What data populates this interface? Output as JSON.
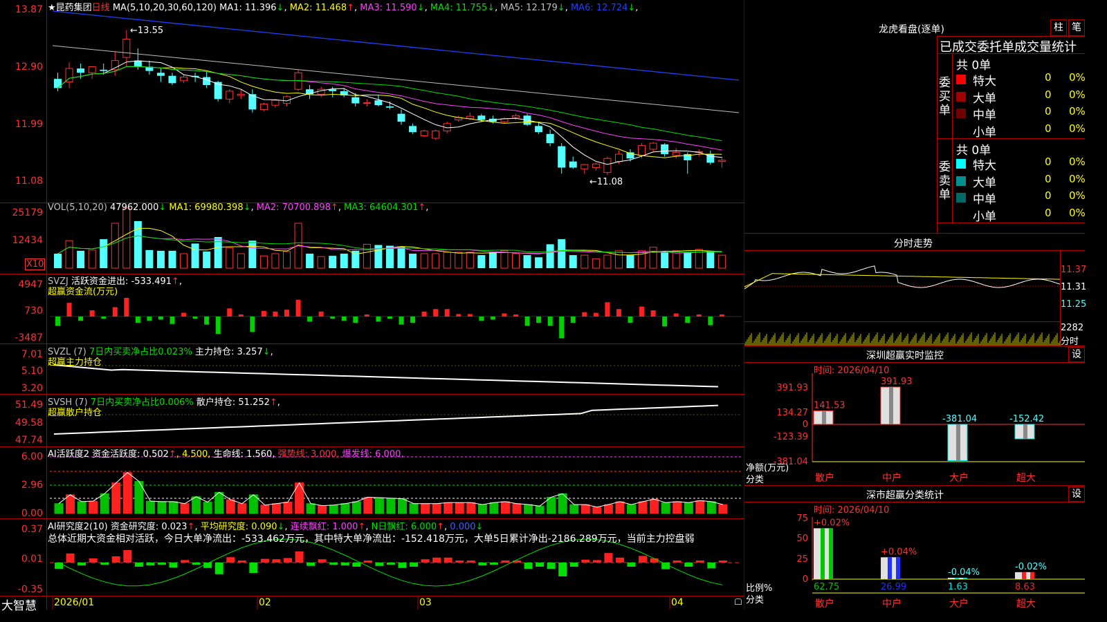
{
  "stock": {
    "star": "★",
    "name": "昆药集团",
    "period": "日线"
  },
  "price_panel": {
    "ma_header": "MA(5,10,20,30,60,120)",
    "ma": [
      {
        "label": "MA1:",
        "value": "11.396",
        "arrow": "↓",
        "color": "#ffffff"
      },
      {
        "label": "MA2:",
        "value": "11.468",
        "arrow": "↑",
        "color": "#ffff00"
      },
      {
        "label": "MA3:",
        "value": "11.590",
        "arrow": "↓",
        "color": "#ff40ff"
      },
      {
        "label": "MA4:",
        "value": "11.755",
        "arrow": "↓",
        "color": "#00e000"
      },
      {
        "label": "MA5:",
        "value": "12.179",
        "arrow": "↓",
        "color": "#c0c0c0"
      },
      {
        "label": "MA6:",
        "value": "12.724",
        "arrow": "↓",
        "color": "#2040ff"
      }
    ],
    "y_ticks": [
      "13.87",
      "12.90",
      "11.99",
      "11.08"
    ],
    "high_label": "13.55",
    "low_label": "11.08"
  },
  "vol_panel": {
    "header": "VOL(5,10,20)",
    "value": "47962.000",
    "value_arrow": "↓",
    "ma": [
      {
        "label": "MA1:",
        "value": "69980.398",
        "arrow": "↓",
        "color": "#ffff00"
      },
      {
        "label": "MA2:",
        "value": "70700.898",
        "arrow": "↑",
        "color": "#ff40ff"
      },
      {
        "label": "MA3:",
        "value": "64604.301",
        "arrow": "↑",
        "color": "#00e000"
      }
    ],
    "y_ticks": [
      "25179",
      "12434"
    ],
    "unit": "X10"
  },
  "svzj_panel": {
    "header": "SVZJ",
    "label": "活跃资金进出:",
    "value": "-533.491",
    "arrow": "↑",
    "sub": "超赢资金流(万元)",
    "y_ticks": [
      "4947",
      "730",
      "-3487"
    ]
  },
  "svzl_panel": {
    "header": "SVZL (7)",
    "label": "7日内买卖净占比0.023%",
    "label2": "主力持仓:",
    "value": "3.257",
    "arrow": "↓",
    "sub": "超赢主力持仓",
    "y_ticks": [
      "7.01",
      "5.10",
      "3.20"
    ]
  },
  "svsh_panel": {
    "header": "SVSH (7)",
    "label": "7日内买卖净占比0.006%",
    "label2": "散户持仓:",
    "value": "51.252",
    "arrow": "↑",
    "sub": "超赢散户持仓",
    "y_ticks": [
      "51.49",
      "49.58",
      "47.74"
    ]
  },
  "ai_active_panel": {
    "header": "AI活跃度2",
    "label": "资金活跃度:",
    "value": "0.502",
    "v2": "4.500",
    "label3": "生命线:",
    "v3": "1.560",
    "label4": "强势线:",
    "v4": "3.000",
    "label5": "爆发线:",
    "v5": "6.000",
    "y_ticks": [
      "6.00",
      "2.96",
      "0.00"
    ]
  },
  "ai_research_panel": {
    "header": "AI研究度2(10)",
    "label": "资金研究度:",
    "value": "0.023",
    "label2": "平均研究度:",
    "value2": "0.090",
    "label3": "连续飘红:",
    "value3": "1.000",
    "label4": "N日飘红:",
    "value4": "6.000",
    "value5": "0.000",
    "summary": "总体近期大资金相对活跃，今日大单净流出：-533.462万元，其中特大单净流出：-152.418万元，大单5日累计净出-2186.289万元，当前主力控盘弱",
    "y_ticks": [
      "0.37",
      "0.01",
      "-0.35"
    ]
  },
  "date_axis": {
    "brand": "大智慧",
    "labels": [
      "2026/01",
      "02",
      "03",
      "04"
    ]
  },
  "right": {
    "dragon_title": "龙虎看盘(逐单)",
    "tab_zhu": "柱",
    "tab_bi": "笔",
    "stat_title": "已成交委托单成交量统计",
    "buy_side": "委买单",
    "sell_side": "委卖单",
    "buy_total": "共 0单",
    "sell_total": "共 0单",
    "buy_rows": [
      {
        "name": "特大",
        "count": "0",
        "pct": "0%",
        "color": "#ff0000"
      },
      {
        "name": "大单",
        "count": "0",
        "pct": "0%",
        "color": "#a00000"
      },
      {
        "name": "中单",
        "count": "0",
        "pct": "0%",
        "color": "#700000"
      },
      {
        "name": "小单",
        "count": "0",
        "pct": "0%",
        "color": ""
      }
    ],
    "sell_rows": [
      {
        "name": "特大",
        "count": "0",
        "pct": "0%",
        "color": "#00ffff"
      },
      {
        "name": "大单",
        "count": "0",
        "pct": "0%",
        "color": "#009090"
      },
      {
        "name": "中单",
        "count": "0",
        "pct": "0%",
        "color": "#006868"
      },
      {
        "name": "小单",
        "count": "0",
        "pct": "0%",
        "color": ""
      }
    ],
    "intraday_title": "分时走势",
    "intraday_y": [
      "11.37",
      "11.31",
      "11.25"
    ],
    "intraday_vol": "2282",
    "intraday_vol_unit": "分时",
    "monitor_title": "深圳超赢实时监控",
    "set_label": "设",
    "monitor_time": "时间: 2026/04/10",
    "monitor_y": [
      "391.93",
      "134.27",
      "0",
      "-123.39",
      "-381.04"
    ],
    "monitor_ylabel": "净额(万元)",
    "monitor_xlabel": "分类",
    "monitor_bars": [
      {
        "cat": "散户",
        "value": 141.53,
        "label": "141.53"
      },
      {
        "cat": "中户",
        "value": 391.93,
        "label": "391.93"
      },
      {
        "cat": "大户",
        "value": -381.04,
        "label": "-381.04"
      },
      {
        "cat": "超大",
        "value": -152.42,
        "label": "-152.42"
      }
    ],
    "class_title": "深市超赢分类统计",
    "class_time": "时间: 2026/04/10",
    "class_y": [
      "75",
      "50",
      "25",
      "0"
    ],
    "class_ylabel": "比例%",
    "class_xlabel": "分类",
    "class_bars": [
      {
        "cat": "散户",
        "value": 62.75,
        "label": "62.75",
        "delta": "+0.02%",
        "color": "#00c800"
      },
      {
        "cat": "中户",
        "value": 26.99,
        "label": "26.99",
        "delta": "+0.04%",
        "color": "#2030ff"
      },
      {
        "cat": "大户",
        "value": 1.63,
        "label": "1.63",
        "delta": "-0.04%",
        "color": "#00e0e0"
      },
      {
        "cat": "超大",
        "value": 8.63,
        "label": "8.63",
        "delta": "-0.02%",
        "color": "#ff2020"
      }
    ]
  },
  "chart_data": {
    "type": "candlestick",
    "ylim": [
      11.08,
      13.87
    ],
    "dates": [
      "2026/01",
      "02",
      "03",
      "04"
    ],
    "ohlc": [
      [
        12.75,
        12.85,
        12.55,
        12.6
      ],
      [
        12.7,
        13.02,
        12.6,
        12.92
      ],
      [
        12.92,
        13.0,
        12.75,
        12.85
      ],
      [
        12.85,
        12.96,
        12.75,
        12.95
      ],
      [
        12.9,
        13.0,
        12.82,
        12.88
      ],
      [
        12.9,
        13.2,
        12.8,
        13.05
      ],
      [
        13.1,
        13.55,
        12.95,
        13.4
      ],
      [
        13.05,
        13.25,
        12.9,
        12.95
      ],
      [
        12.95,
        13.05,
        12.82,
        12.88
      ],
      [
        12.85,
        12.92,
        12.7,
        12.8
      ],
      [
        12.8,
        12.85,
        12.65,
        12.68
      ],
      [
        12.72,
        12.82,
        12.68,
        12.78
      ],
      [
        12.8,
        12.85,
        12.7,
        12.78
      ],
      [
        12.78,
        12.88,
        12.6,
        12.65
      ],
      [
        12.7,
        12.72,
        12.38,
        12.42
      ],
      [
        12.42,
        12.58,
        12.35,
        12.55
      ],
      [
        12.48,
        12.58,
        12.42,
        12.5
      ],
      [
        12.5,
        12.58,
        12.2,
        12.25
      ],
      [
        12.25,
        12.36,
        12.22,
        12.34
      ],
      [
        12.32,
        12.42,
        12.28,
        12.4
      ],
      [
        12.35,
        12.48,
        12.3,
        12.46
      ],
      [
        12.58,
        12.9,
        12.55,
        12.85
      ],
      [
        12.58,
        12.65,
        12.42,
        12.5
      ],
      [
        12.5,
        12.62,
        12.45,
        12.58
      ],
      [
        12.58,
        12.62,
        12.45,
        12.55
      ],
      [
        12.55,
        12.6,
        12.45,
        12.48
      ],
      [
        12.45,
        12.52,
        12.3,
        12.35
      ],
      [
        12.35,
        12.42,
        12.3,
        12.36
      ],
      [
        12.4,
        12.48,
        12.3,
        12.32
      ],
      [
        12.3,
        12.38,
        12.25,
        12.28
      ],
      [
        12.18,
        12.25,
        12.0,
        12.05
      ],
      [
        11.98,
        12.02,
        11.85,
        11.88
      ],
      [
        11.82,
        11.92,
        11.8,
        11.9
      ],
      [
        11.78,
        11.92,
        11.75,
        11.9
      ],
      [
        11.9,
        12.05,
        11.86,
        12.02
      ],
      [
        12.08,
        12.15,
        12.05,
        12.12
      ],
      [
        12.1,
        12.2,
        12.08,
        12.14
      ],
      [
        12.15,
        12.18,
        12.05,
        12.08
      ],
      [
        12.1,
        12.15,
        12.02,
        12.05
      ],
      [
        12.05,
        12.12,
        12.02,
        12.1
      ],
      [
        12.12,
        12.18,
        12.08,
        12.15
      ],
      [
        12.15,
        12.18,
        11.98,
        12.0
      ],
      [
        11.98,
        12.05,
        11.85,
        11.88
      ],
      [
        11.85,
        11.92,
        11.65,
        11.7
      ],
      [
        11.65,
        11.7,
        11.2,
        11.3
      ],
      [
        11.4,
        11.48,
        11.28,
        11.3
      ],
      [
        11.28,
        11.36,
        11.2,
        11.35
      ],
      [
        11.3,
        11.38,
        11.25,
        11.36
      ],
      [
        11.22,
        11.48,
        11.18,
        11.45
      ],
      [
        11.4,
        11.58,
        11.36,
        11.52
      ],
      [
        11.55,
        11.6,
        11.4,
        11.45
      ],
      [
        11.5,
        11.7,
        11.45,
        11.66
      ],
      [
        11.6,
        11.72,
        11.56,
        11.7
      ],
      [
        11.68,
        11.7,
        11.48,
        11.52
      ],
      [
        11.5,
        11.62,
        11.45,
        11.55
      ],
      [
        11.52,
        11.55,
        11.2,
        11.42
      ],
      [
        11.55,
        11.6,
        11.48,
        11.56
      ],
      [
        11.52,
        11.58,
        11.35,
        11.38
      ],
      [
        11.4,
        11.48,
        11.3,
        11.42
      ]
    ],
    "volume": [
      2.0,
      3.8,
      2.4,
      2.5,
      4.0,
      6.2,
      8.3,
      6.5,
      2.5,
      2.4,
      2.4,
      2.0,
      3.4,
      2.3,
      4.3,
      2.8,
      2.0,
      3.8,
      1.7,
      2.0,
      2.3,
      6.2,
      2.0,
      1.6,
      1.7,
      2.0,
      2.4,
      3.3,
      3.2,
      3.1,
      3.0,
      2.0,
      2.0,
      2.0,
      2.2,
      2.2,
      2.2,
      1.8,
      2.2,
      2.4,
      2.0,
      1.8,
      1.5,
      3.3,
      4.0,
      1.8,
      1.8,
      1.3,
      1.8,
      2.4,
      1.8,
      2.4,
      2.9,
      2.2,
      2.4,
      2.2,
      2.6,
      2.4,
      1.8
    ]
  }
}
